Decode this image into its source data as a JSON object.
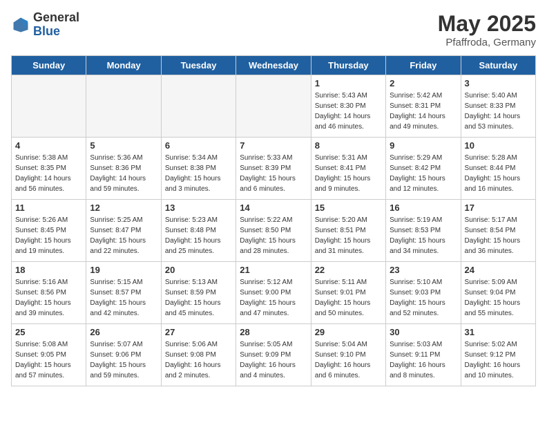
{
  "header": {
    "logo": {
      "general": "General",
      "blue": "Blue"
    },
    "title": "May 2025",
    "location": "Pfaffroda, Germany"
  },
  "weekdays": [
    "Sunday",
    "Monday",
    "Tuesday",
    "Wednesday",
    "Thursday",
    "Friday",
    "Saturday"
  ],
  "weeks": [
    [
      {
        "day": "",
        "info": ""
      },
      {
        "day": "",
        "info": ""
      },
      {
        "day": "",
        "info": ""
      },
      {
        "day": "",
        "info": ""
      },
      {
        "day": "1",
        "info": "Sunrise: 5:43 AM\nSunset: 8:30 PM\nDaylight: 14 hours\nand 46 minutes."
      },
      {
        "day": "2",
        "info": "Sunrise: 5:42 AM\nSunset: 8:31 PM\nDaylight: 14 hours\nand 49 minutes."
      },
      {
        "day": "3",
        "info": "Sunrise: 5:40 AM\nSunset: 8:33 PM\nDaylight: 14 hours\nand 53 minutes."
      }
    ],
    [
      {
        "day": "4",
        "info": "Sunrise: 5:38 AM\nSunset: 8:35 PM\nDaylight: 14 hours\nand 56 minutes."
      },
      {
        "day": "5",
        "info": "Sunrise: 5:36 AM\nSunset: 8:36 PM\nDaylight: 14 hours\nand 59 minutes."
      },
      {
        "day": "6",
        "info": "Sunrise: 5:34 AM\nSunset: 8:38 PM\nDaylight: 15 hours\nand 3 minutes."
      },
      {
        "day": "7",
        "info": "Sunrise: 5:33 AM\nSunset: 8:39 PM\nDaylight: 15 hours\nand 6 minutes."
      },
      {
        "day": "8",
        "info": "Sunrise: 5:31 AM\nSunset: 8:41 PM\nDaylight: 15 hours\nand 9 minutes."
      },
      {
        "day": "9",
        "info": "Sunrise: 5:29 AM\nSunset: 8:42 PM\nDaylight: 15 hours\nand 12 minutes."
      },
      {
        "day": "10",
        "info": "Sunrise: 5:28 AM\nSunset: 8:44 PM\nDaylight: 15 hours\nand 16 minutes."
      }
    ],
    [
      {
        "day": "11",
        "info": "Sunrise: 5:26 AM\nSunset: 8:45 PM\nDaylight: 15 hours\nand 19 minutes."
      },
      {
        "day": "12",
        "info": "Sunrise: 5:25 AM\nSunset: 8:47 PM\nDaylight: 15 hours\nand 22 minutes."
      },
      {
        "day": "13",
        "info": "Sunrise: 5:23 AM\nSunset: 8:48 PM\nDaylight: 15 hours\nand 25 minutes."
      },
      {
        "day": "14",
        "info": "Sunrise: 5:22 AM\nSunset: 8:50 PM\nDaylight: 15 hours\nand 28 minutes."
      },
      {
        "day": "15",
        "info": "Sunrise: 5:20 AM\nSunset: 8:51 PM\nDaylight: 15 hours\nand 31 minutes."
      },
      {
        "day": "16",
        "info": "Sunrise: 5:19 AM\nSunset: 8:53 PM\nDaylight: 15 hours\nand 34 minutes."
      },
      {
        "day": "17",
        "info": "Sunrise: 5:17 AM\nSunset: 8:54 PM\nDaylight: 15 hours\nand 36 minutes."
      }
    ],
    [
      {
        "day": "18",
        "info": "Sunrise: 5:16 AM\nSunset: 8:56 PM\nDaylight: 15 hours\nand 39 minutes."
      },
      {
        "day": "19",
        "info": "Sunrise: 5:15 AM\nSunset: 8:57 PM\nDaylight: 15 hours\nand 42 minutes."
      },
      {
        "day": "20",
        "info": "Sunrise: 5:13 AM\nSunset: 8:59 PM\nDaylight: 15 hours\nand 45 minutes."
      },
      {
        "day": "21",
        "info": "Sunrise: 5:12 AM\nSunset: 9:00 PM\nDaylight: 15 hours\nand 47 minutes."
      },
      {
        "day": "22",
        "info": "Sunrise: 5:11 AM\nSunset: 9:01 PM\nDaylight: 15 hours\nand 50 minutes."
      },
      {
        "day": "23",
        "info": "Sunrise: 5:10 AM\nSunset: 9:03 PM\nDaylight: 15 hours\nand 52 minutes."
      },
      {
        "day": "24",
        "info": "Sunrise: 5:09 AM\nSunset: 9:04 PM\nDaylight: 15 hours\nand 55 minutes."
      }
    ],
    [
      {
        "day": "25",
        "info": "Sunrise: 5:08 AM\nSunset: 9:05 PM\nDaylight: 15 hours\nand 57 minutes."
      },
      {
        "day": "26",
        "info": "Sunrise: 5:07 AM\nSunset: 9:06 PM\nDaylight: 15 hours\nand 59 minutes."
      },
      {
        "day": "27",
        "info": "Sunrise: 5:06 AM\nSunset: 9:08 PM\nDaylight: 16 hours\nand 2 minutes."
      },
      {
        "day": "28",
        "info": "Sunrise: 5:05 AM\nSunset: 9:09 PM\nDaylight: 16 hours\nand 4 minutes."
      },
      {
        "day": "29",
        "info": "Sunrise: 5:04 AM\nSunset: 9:10 PM\nDaylight: 16 hours\nand 6 minutes."
      },
      {
        "day": "30",
        "info": "Sunrise: 5:03 AM\nSunset: 9:11 PM\nDaylight: 16 hours\nand 8 minutes."
      },
      {
        "day": "31",
        "info": "Sunrise: 5:02 AM\nSunset: 9:12 PM\nDaylight: 16 hours\nand 10 minutes."
      }
    ]
  ]
}
